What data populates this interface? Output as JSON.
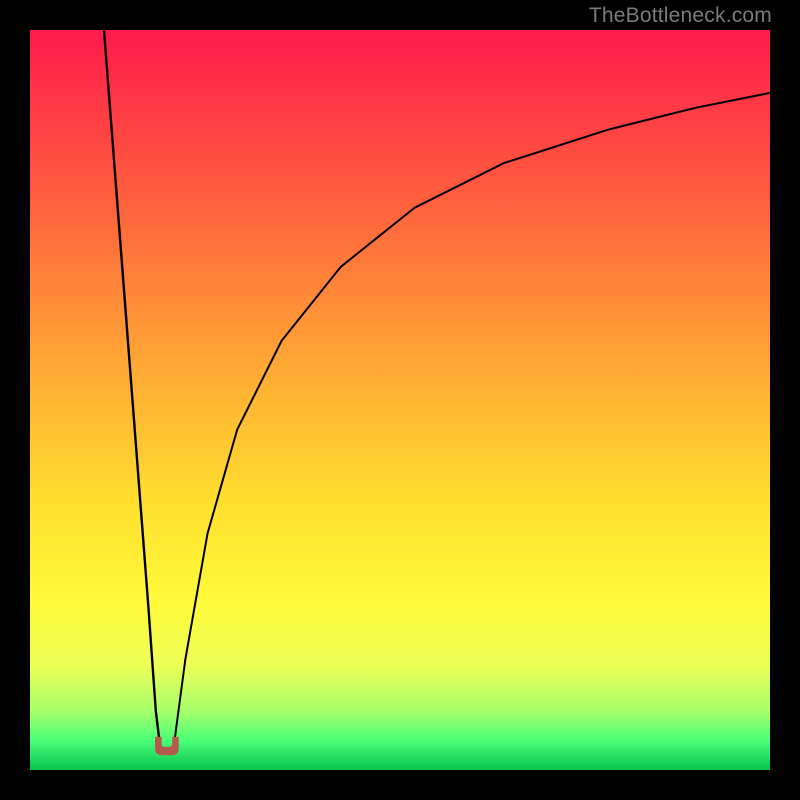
{
  "attribution": "TheBottleneck.com",
  "chart_data": {
    "type": "line",
    "title": "",
    "xlabel": "",
    "ylabel": "",
    "xlim": [
      0,
      100
    ],
    "ylim": [
      0,
      100
    ],
    "grid": false,
    "legend": false,
    "background": {
      "type": "vertical-gradient",
      "description": "Smooth gradient from red (top) through orange/yellow to bright green (bottom); very bottom is deep green",
      "stops": [
        {
          "offset": 0,
          "color": "#ff1a4b"
        },
        {
          "offset": 22,
          "color": "#ff5c3e"
        },
        {
          "offset": 45,
          "color": "#ffa734"
        },
        {
          "offset": 65,
          "color": "#ffe22e"
        },
        {
          "offset": 78,
          "color": "#fffb3c"
        },
        {
          "offset": 86,
          "color": "#ecff57"
        },
        {
          "offset": 92,
          "color": "#a6ff6a"
        },
        {
          "offset": 96,
          "color": "#4bff78"
        },
        {
          "offset": 100,
          "color": "#06c24d"
        }
      ]
    },
    "series": [
      {
        "name": "left-branch",
        "description": "Steep nearly-linear descent from top-left toward the dip",
        "color": "#000000",
        "x": [
          10,
          11,
          12,
          13,
          14,
          15,
          16,
          17,
          17.6
        ],
        "y": [
          100,
          87,
          74,
          61,
          48,
          35,
          22,
          8,
          3
        ]
      },
      {
        "name": "right-branch",
        "description": "Logarithmic-like rise from the dip up toward the top-right",
        "color": "#000000",
        "x": [
          19.4,
          21,
          24,
          28,
          34,
          42,
          52,
          64,
          78,
          90,
          100
        ],
        "y": [
          3,
          15,
          32,
          46,
          58,
          68,
          76,
          82,
          86.5,
          89.5,
          91.5
        ]
      }
    ],
    "markers": [
      {
        "name": "dip-marker",
        "description": "Small rounded U-shaped marker at the curve minimum",
        "color": "#b7584e",
        "x": 18.5,
        "y": 2,
        "width_pct": 3.2,
        "height_pct": 2.5
      }
    ]
  }
}
